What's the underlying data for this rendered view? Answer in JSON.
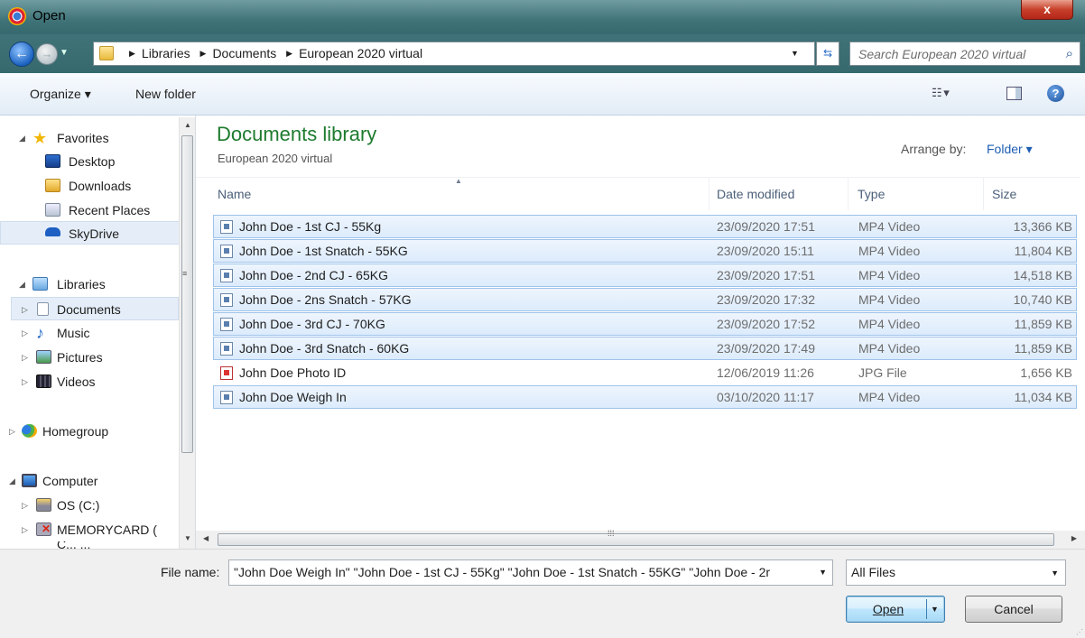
{
  "window": {
    "title": "Open",
    "close_glyph": "x"
  },
  "nav": {
    "back_glyph": "←",
    "forward_glyph": "→",
    "breadcrumbs": [
      "Libraries",
      "Documents",
      "European 2020 virtual"
    ],
    "search_placeholder": "Search European 2020 virtual"
  },
  "toolbar": {
    "organize": "Organize ▾",
    "new_folder": "New folder",
    "help_glyph": "?"
  },
  "sidebar": {
    "favorites": "Favorites",
    "desktop": "Desktop",
    "downloads": "Downloads",
    "recent_places": "Recent Places",
    "skydrive": "SkyDrive",
    "libraries": "Libraries",
    "documents": "Documents",
    "music": "Music",
    "pictures": "Pictures",
    "videos": "Videos",
    "homegroup": "Homegroup",
    "computer": "Computer",
    "os_c": "OS (C:)",
    "memorycard": "MEMORYCARD (",
    "partial": "C...  ..."
  },
  "main": {
    "library_title": "Documents library",
    "library_sub": "European 2020 virtual",
    "arrange_label": "Arrange by:",
    "arrange_value": "Folder ▾",
    "columns": {
      "name": "Name",
      "date": "Date modified",
      "type": "Type",
      "size": "Size"
    },
    "files": [
      {
        "name": "John Doe - 1st CJ - 55Kg",
        "date": "23/09/2020 17:51",
        "type": "MP4 Video",
        "size": "13,366 KB",
        "selected": true
      },
      {
        "name": "John Doe - 1st Snatch - 55KG",
        "date": "23/09/2020 15:11",
        "type": "MP4 Video",
        "size": "11,804 KB",
        "selected": true
      },
      {
        "name": "John Doe - 2nd CJ - 65KG",
        "date": "23/09/2020 17:51",
        "type": "MP4 Video",
        "size": "14,518 KB",
        "selected": true
      },
      {
        "name": "John Doe - 2ns Snatch - 57KG",
        "date": "23/09/2020 17:32",
        "type": "MP4 Video",
        "size": "10,740 KB",
        "selected": true
      },
      {
        "name": "John Doe - 3rd CJ - 70KG",
        "date": "23/09/2020 17:52",
        "type": "MP4 Video",
        "size": "11,859 KB",
        "selected": true
      },
      {
        "name": "John Doe - 3rd Snatch - 60KG",
        "date": "23/09/2020 17:49",
        "type": "MP4 Video",
        "size": "11,859 KB",
        "selected": true
      },
      {
        "name": "John Doe Photo ID",
        "date": "12/06/2019 11:26",
        "type": "JPG File",
        "size": "1,656 KB",
        "selected": false
      },
      {
        "name": "John Doe Weigh In",
        "date": "03/10/2020 11:17",
        "type": "MP4 Video",
        "size": "11,034 KB",
        "selected": true
      }
    ]
  },
  "footer": {
    "file_name_label": "File name:",
    "file_name_value": "\"John Doe Weigh In\" \"John Doe - 1st CJ - 55Kg\" \"John Doe - 1st Snatch - 55KG\" \"John Doe - 2r",
    "file_type_value": "All Files",
    "open_label": "Open",
    "cancel_label": "Cancel"
  },
  "colors": {
    "accent_title": "#1e7b2e",
    "selection": "#dcebfc",
    "link": "#1e5fb3"
  }
}
